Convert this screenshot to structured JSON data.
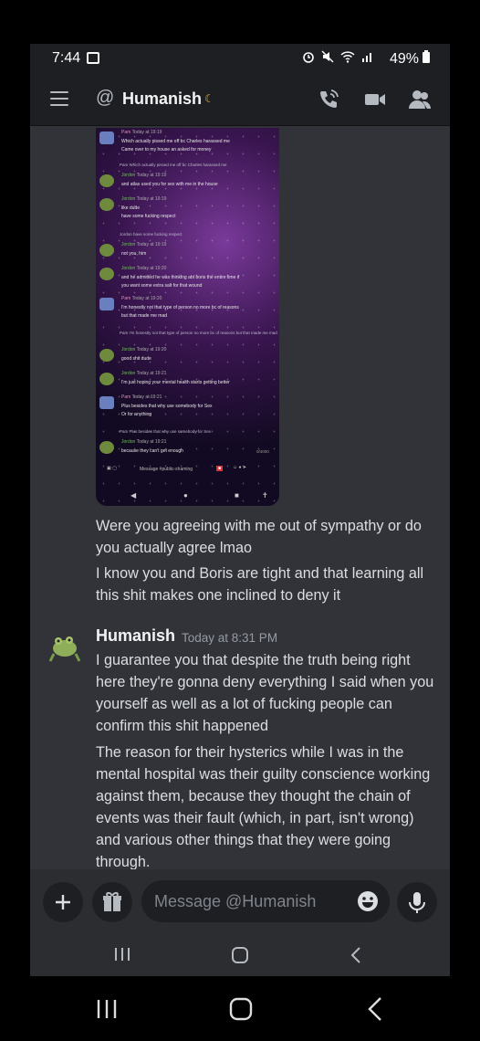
{
  "status_bar": {
    "time": "7:44",
    "battery": "49%",
    "icons": [
      "image-icon",
      "nfc-icon",
      "alarm-icon",
      "mute-icon",
      "wifi-icon",
      "signal-icon",
      "battery-icon"
    ]
  },
  "header": {
    "title": "Humanish",
    "status": "idle-moon"
  },
  "screenshot": {
    "messages": [
      {
        "author": "Pam",
        "time": "Today at 19:19",
        "lines": [
          "Which actually pissed me off bc Charles harassed me",
          "Came over to my house an asked for money"
        ]
      },
      {
        "reply": "Pam Which actually pissed me off bc Charles harassed me"
      },
      {
        "author": "Jordon",
        "time": "Today at 19:19",
        "lines": [
          "and atlas used you for sex with me in the house"
        ]
      },
      {
        "author": "Jordon",
        "time": "Today at 19:19",
        "lines": [
          "like dude",
          "have some fucking respect"
        ]
      },
      {
        "reply": "Jordon have some fucking respect"
      },
      {
        "author": "Jordon",
        "time": "Today at 19:19",
        "lines": [
          "not you, him"
        ]
      },
      {
        "author": "Jordon",
        "time": "Today at 19:20",
        "lines": [
          "and he admitted he was thinking abt boris the entire time if",
          "you want some extra salt for that wound"
        ]
      },
      {
        "author": "Pam",
        "time": "Today at 19:20",
        "lines": [
          "I'm honestly not that type of person no more bc of reasons",
          "but that made me mad"
        ]
      },
      {
        "reply": "Pam I'm honestly not that type of person no more bc of reasons but that made me mad"
      },
      {
        "author": "Jordon",
        "time": "Today at 19:20",
        "lines": [
          "good shit dude"
        ]
      },
      {
        "author": "Jordon",
        "time": "Today at 19:21",
        "lines": [
          "I'm just hoping your mental health starts getting better"
        ]
      },
      {
        "author": "Pam",
        "time": "Today at 19:21",
        "lines": [
          "Plus besides that why use somebody for Sex",
          "Or for anything"
        ]
      },
      {
        "reply": "Pam Plus besides that why use somebody for Sex"
      },
      {
        "author": "Jordon",
        "time": "Today at 19:21",
        "lines": [
          "because they can't get enough"
        ]
      }
    ],
    "counter": "0/4000",
    "input_placeholder": "Message #public-shaming"
  },
  "messages": {
    "m1": "Were you agreeing with me out of sympathy or do you actually agree lmao",
    "m2": "I know you and Boris are tight and that learning all this shit makes one inclined to deny it",
    "author": "Humanish",
    "timestamp": "Today at 8:31 PM",
    "m3": "I guarantee you that despite the truth being right here they're gonna deny everything I said when you yourself as well as a lot of fucking people can confirm this shit happened",
    "m4": "The reason for their hysterics while I was in the mental hospital was their guilty conscience working against them, because they thought the chain of events was their fault (which, in part, isn't wrong) and various other things that they were going through."
  },
  "composer": {
    "placeholder": "Message @Humanish"
  }
}
